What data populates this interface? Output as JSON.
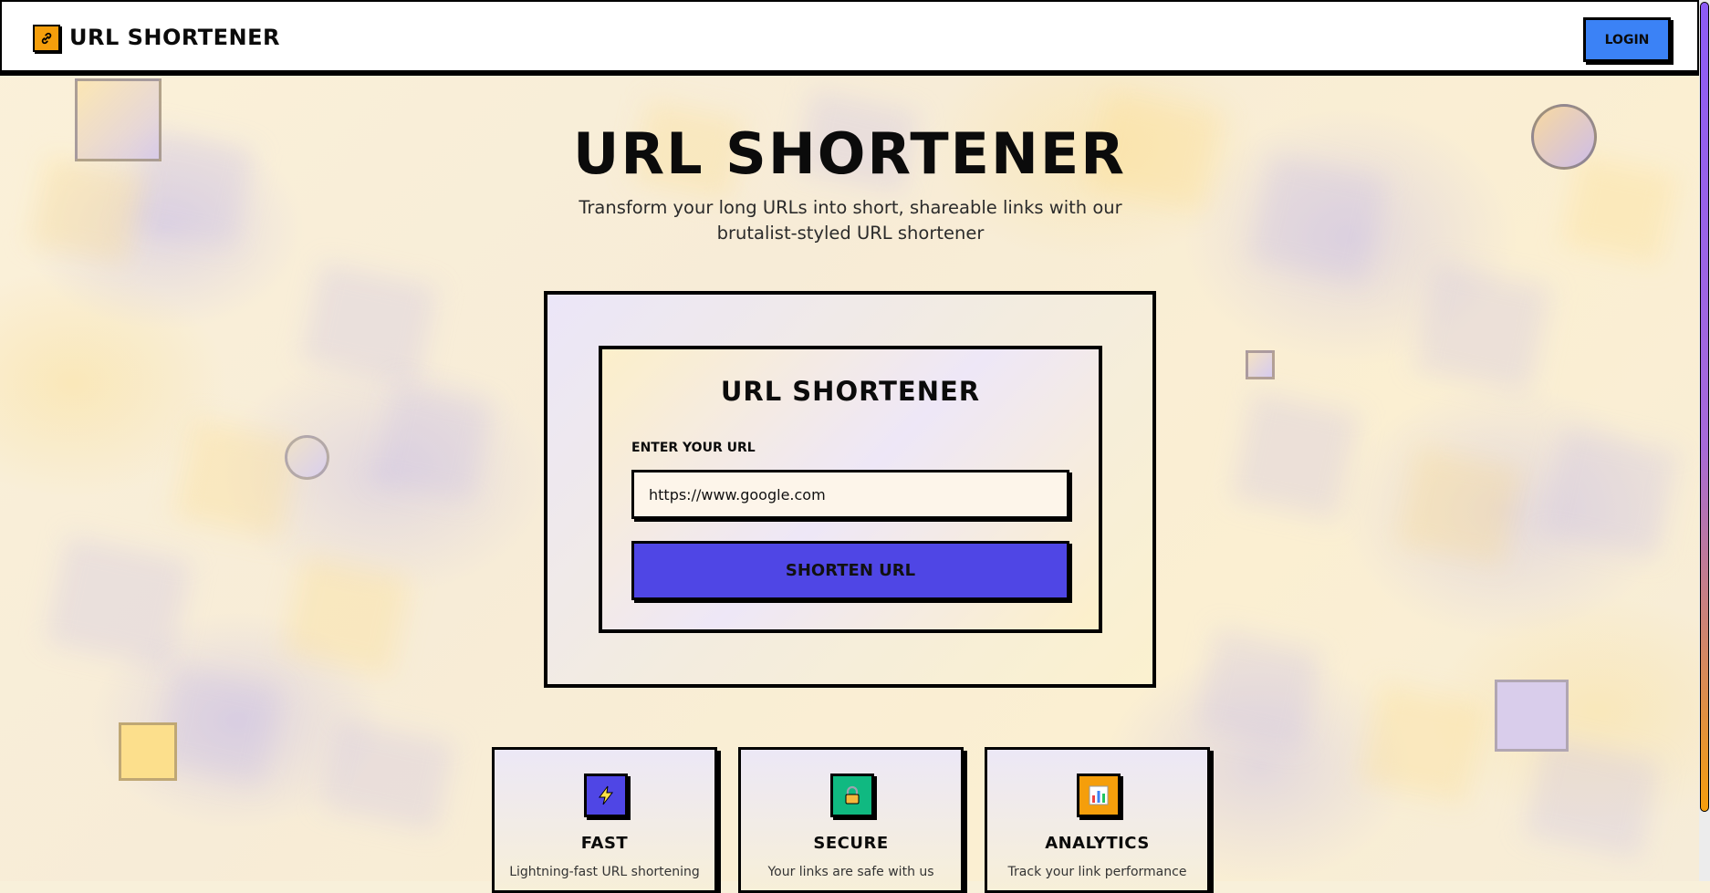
{
  "navbar": {
    "brand": "URL SHORTENER",
    "logo_icon": "link-icon",
    "login_label": "LOGIN"
  },
  "hero": {
    "title": "URL SHORTENER",
    "subtitle": "Transform your long URLs into short, shareable links with our brutalist-styled URL shortener"
  },
  "form": {
    "card_title": "URL SHORTENER",
    "label": "ENTER YOUR URL",
    "input_value": "https://www.google.com",
    "button_label": "SHORTEN URL"
  },
  "features": [
    {
      "title": "FAST",
      "desc": "Lightning-fast URL shortening",
      "icon": "lightning-icon",
      "color": "#4f46e5"
    },
    {
      "title": "SECURE",
      "desc": "Your links are safe with us",
      "icon": "lock-icon",
      "color": "#10b981"
    },
    {
      "title": "ANALYTICS",
      "desc": "Track your link performance",
      "icon": "bar-chart-icon",
      "color": "#f59e0b"
    }
  ],
  "colors": {
    "accent_primary": "#4f46e5",
    "login_blue": "#3b82f6",
    "logo_orange": "#f59e0b",
    "secure_green": "#10b981"
  }
}
